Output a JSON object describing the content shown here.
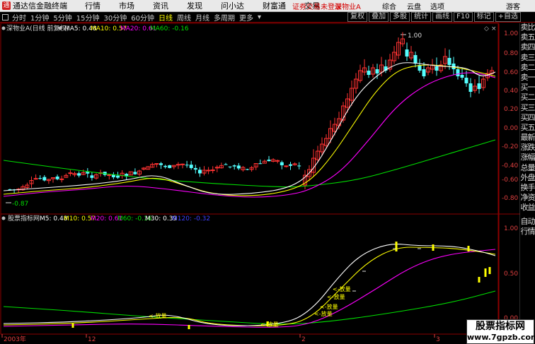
{
  "titlebar": {
    "app_title": "通达信金融终端",
    "menus": [
      "行情",
      "市场",
      "资讯",
      "发现",
      "问小达",
      "财富通",
      "交易"
    ],
    "notice": "证券交易未登录",
    "stock": "深物业A",
    "links": [
      "综合",
      "云盘",
      "选项"
    ],
    "guest": "游客"
  },
  "toolbar": {
    "periods": [
      "分时",
      "1分钟",
      "5分钟",
      "15分钟",
      "30分钟",
      "60分钟",
      "日线",
      "周线",
      "月线",
      "多周期",
      "更多"
    ],
    "selected": "日线",
    "right": [
      "复权",
      "叠加",
      "多股",
      "统计",
      "画线",
      "F10",
      "标记",
      "+自选"
    ]
  },
  "main_chart": {
    "label": "深物业A(日线 前复权)",
    "ma5": "MA5: 0.48",
    "ma10": "MA10: 0.57",
    "ma20": "MA20: 0.61",
    "ma60": "MA60: -0.16",
    "high_marker": "1.00",
    "low_marker": "-0.87",
    "y_ticks": [
      "1.00",
      "0.80",
      "0.60",
      "0.40",
      "0.20",
      "0.00",
      "-0.20",
      "-0.40",
      "-0.60",
      "-0.80"
    ]
  },
  "sub_chart": {
    "label": "股票指标网",
    "m5": "M5: 0.48",
    "m10": "M10: 0.57",
    "m20": "M20: 0.61",
    "m60": "M60: -0.16",
    "m30": "M30: 0.39",
    "m120": "M120: -0.32",
    "y_ticks": [
      "1.00",
      "0.50",
      "0.00"
    ],
    "signal_label": "<-放量"
  },
  "x_axis": [
    "2003年",
    "12",
    "2",
    "3"
  ],
  "sidepanel": [
    "卖比",
    "卖五",
    "卖四",
    "卖三",
    "卖二",
    "卖一",
    "买一",
    "买二",
    "买三",
    "买四",
    "买五",
    "最新",
    "涨跌",
    "涨幅",
    "总量",
    "外盘",
    "换手",
    "净资",
    "收益",
    "自动",
    "行情"
  ],
  "watermark": {
    "line1": "股票指标网",
    "line2": "www.7gpzb.com"
  },
  "colors": {
    "up": "#ff3232",
    "down": "#54ffff",
    "ma5": "#ffffff",
    "ma10": "#ffff00",
    "ma20": "#ff00ff",
    "ma60": "#00e000",
    "axis": "#e04040",
    "grid": "#8b0000"
  }
}
